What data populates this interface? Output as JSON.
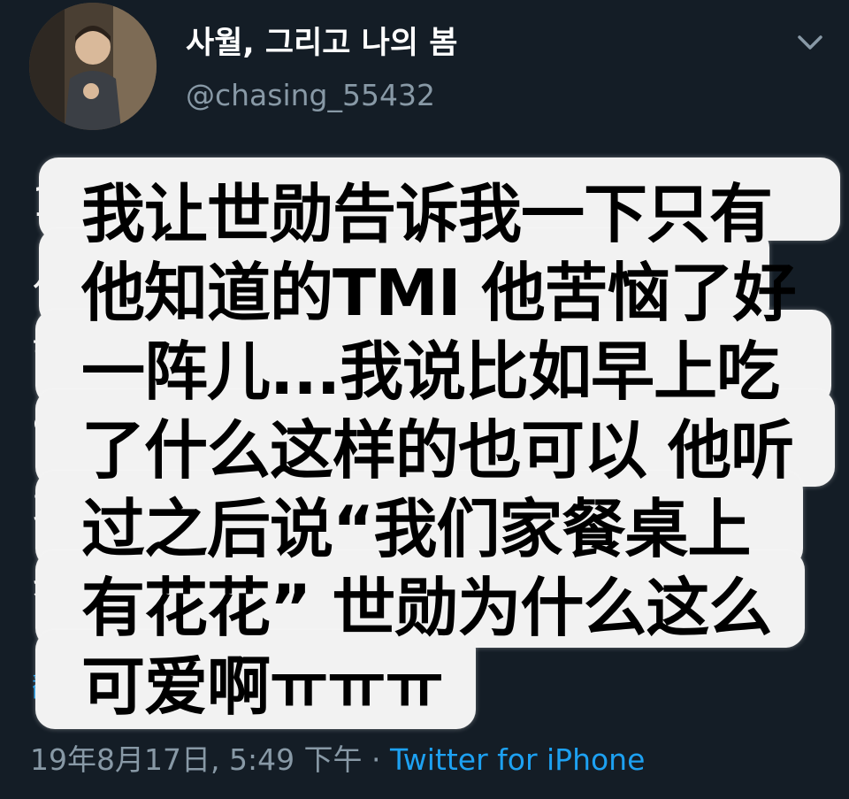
{
  "tweet": {
    "display_name": "사월, 그리고 나의 봄",
    "username": "@chasing_55432",
    "menu_icon": "chevron-down-icon",
    "avatar_icon": "profile-photo",
    "body_lines": [
      "190817 세훈 대구 팬싸 후기",
      "세훈이 다 하는 TMI 어떤 거 고민",
      "했는데 그 냥 아침 밥 어 보면",
      "었 어 세훈이가 하는 말 식탁 위",
      "희 우리 집 식탁 위에 꽃 이 엘",
      "케 세훈 진짜 귀엽다"
    ],
    "translate_label": "翻译推文",
    "timestamp": "19年8月17日, 5:49 下午",
    "separator": " · ",
    "source": "Twitter for iPhone"
  },
  "overlay": {
    "lines": [
      "我让世勋告诉我一下只有",
      "他知道的TMI 他苦恼了好",
      "一阵儿...我说比如早上吃",
      "了什么这样的也可以 他听",
      "过之后说“我们家餐桌上",
      "有花花” 世勋为什么这么",
      "可爱啊ㅠㅠㅠ"
    ]
  },
  "colors": {
    "background": "#141d26",
    "secondary_text": "#8899a6",
    "link": "#1da1f2",
    "overlay_box": "#f2f2f2"
  }
}
